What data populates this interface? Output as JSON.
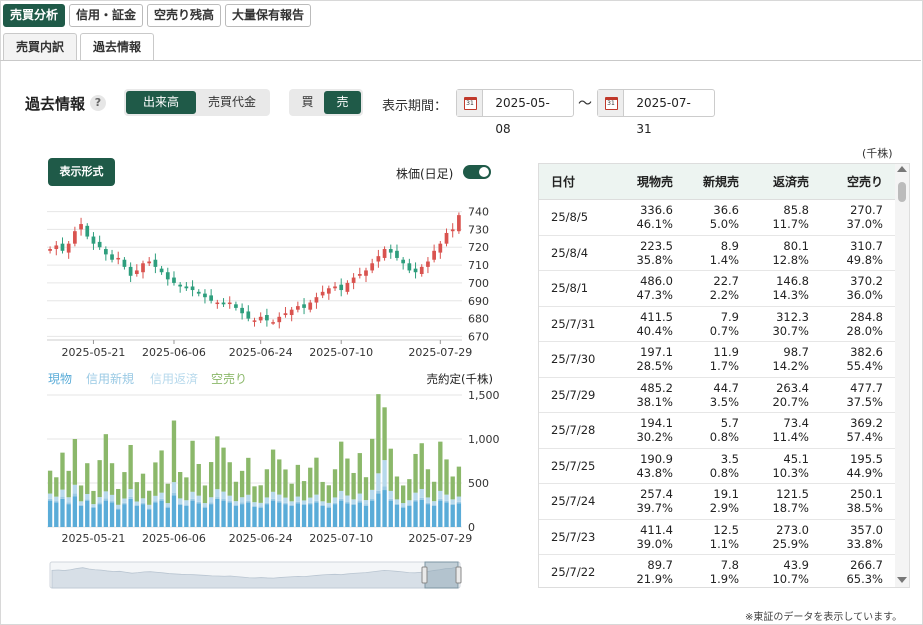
{
  "top_tabs": [
    "売買分析",
    "信用・証金",
    "空売り残高",
    "大量保有報告"
  ],
  "sub_tabs": [
    "売買内訳",
    "過去情報"
  ],
  "controls": {
    "title": "過去情報",
    "help_icon": "?",
    "metric_toggle": [
      "出来高",
      "売買代金"
    ],
    "side_toggle": [
      "買",
      "売"
    ],
    "period_label": "表示期間：",
    "start_date": "2025-05-08",
    "tilde": "〜",
    "end_date": "2025-07-31",
    "format_button": "表示形式",
    "price_label": "株価(日足)"
  },
  "legend": [
    "現物",
    "信用新規",
    "信用返済",
    "空売り"
  ],
  "colors": {
    "accent": "#1f5a48",
    "up": "#d9534f",
    "down": "#2e9e7d",
    "genbutsu": "#5aacd8",
    "shinki": "#99c9e4",
    "hensai": "#b7d9ec",
    "karauri": "#8bb86a"
  },
  "chart_data": [
    {
      "type": "candlestick",
      "x_ticks": [
        "2025-05-21",
        "2025-06-06",
        "2025-06-24",
        "2025-07-10",
        "2025-07-29"
      ],
      "y_ticks": [
        670,
        680,
        690,
        700,
        710,
        720,
        730,
        740
      ],
      "ylim": [
        668,
        742
      ],
      "close": [
        719,
        721,
        718,
        722,
        729,
        733,
        726,
        722,
        720,
        716,
        713,
        714,
        709,
        704,
        707,
        711,
        712,
        709,
        706,
        702,
        700,
        698,
        697,
        696,
        694,
        692,
        690,
        689,
        688,
        689,
        686,
        683,
        680,
        679,
        681,
        679,
        678,
        681,
        683,
        685,
        687,
        686,
        689,
        692,
        695,
        697,
        698,
        696,
        700,
        703,
        705,
        707,
        711,
        715,
        719,
        717,
        714,
        711,
        707,
        706,
        709,
        712,
        718,
        722,
        728,
        730,
        738
      ]
    },
    {
      "type": "stacked-bar",
      "ylabel": "売約定(千株)",
      "y_ticks": [
        0,
        500,
        1000,
        1500
      ],
      "ylim": [
        0,
        1500
      ],
      "series": [
        {
          "name": "現物",
          "values": [
            300,
            280,
            320,
            260,
            350,
            240,
            300,
            220,
            260,
            300,
            280,
            200,
            260,
            320,
            240,
            260,
            200,
            280,
            300,
            220,
            360,
            250,
            240,
            300,
            270,
            220,
            260,
            320,
            300,
            280,
            240,
            260,
            280,
            230,
            220,
            260,
            300,
            280,
            260,
            240,
            270,
            250,
            260,
            280,
            240,
            220,
            260,
            300,
            270,
            250,
            280,
            240,
            300,
            380,
            420,
            300,
            250,
            220,
            240,
            290,
            310,
            260,
            240,
            300,
            280,
            250,
            270
          ]
        },
        {
          "name": "信用新規",
          "values": [
            20,
            15,
            25,
            18,
            30,
            12,
            15,
            10,
            20,
            25,
            15,
            12,
            14,
            22,
            10,
            16,
            12,
            14,
            20,
            12,
            30,
            15,
            14,
            20,
            16,
            12,
            18,
            20,
            22,
            16,
            14,
            18,
            16,
            12,
            14,
            16,
            20,
            18,
            14,
            12,
            16,
            12,
            14,
            18,
            12,
            14,
            16,
            20,
            18,
            14,
            20,
            16,
            22,
            30,
            40,
            20,
            14,
            12,
            14,
            20,
            22,
            16,
            14,
            20,
            18,
            14,
            16
          ]
        },
        {
          "name": "信用返済",
          "values": [
            60,
            50,
            80,
            60,
            100,
            40,
            60,
            30,
            60,
            80,
            70,
            40,
            50,
            90,
            40,
            50,
            40,
            60,
            70,
            40,
            120,
            60,
            50,
            80,
            70,
            40,
            60,
            90,
            80,
            60,
            40,
            60,
            70,
            40,
            40,
            60,
            80,
            70,
            60,
            40,
            60,
            40,
            60,
            70,
            40,
            40,
            60,
            90,
            70,
            50,
            80,
            50,
            100,
            200,
            300,
            90,
            50,
            40,
            50,
            80,
            100,
            60,
            40,
            90,
            70,
            50,
            60
          ]
        },
        {
          "name": "空売り",
          "values": [
            260,
            220,
            420,
            300,
            520,
            180,
            350,
            150,
            420,
            650,
            360,
            180,
            300,
            500,
            220,
            280,
            160,
            380,
            480,
            220,
            700,
            300,
            260,
            580,
            360,
            200,
            400,
            600,
            500,
            380,
            220,
            300,
            420,
            180,
            200,
            320,
            480,
            400,
            320,
            200,
            360,
            220,
            340,
            420,
            220,
            200,
            320,
            560,
            420,
            300,
            460,
            260,
            580,
            900,
            600,
            480,
            260,
            200,
            240,
            440,
            520,
            320,
            220,
            560,
            400,
            260,
            340
          ]
        }
      ]
    }
  ],
  "table": {
    "unit": "(千株)",
    "headers": [
      "日付",
      "現物売",
      "新規売",
      "返済売",
      "空売り"
    ],
    "rows": [
      {
        "date": "25/8/5",
        "v": [
          [
            "336.6",
            "46.1%"
          ],
          [
            "36.6",
            "5.0%"
          ],
          [
            "85.8",
            "11.7%"
          ],
          [
            "270.7",
            "37.0%"
          ]
        ]
      },
      {
        "date": "25/8/4",
        "v": [
          [
            "223.5",
            "35.8%"
          ],
          [
            "8.9",
            "1.4%"
          ],
          [
            "80.1",
            "12.8%"
          ],
          [
            "310.7",
            "49.8%"
          ]
        ]
      },
      {
        "date": "25/8/1",
        "v": [
          [
            "486.0",
            "47.3%"
          ],
          [
            "22.7",
            "2.2%"
          ],
          [
            "146.8",
            "14.3%"
          ],
          [
            "370.2",
            "36.0%"
          ]
        ]
      },
      {
        "date": "25/7/31",
        "v": [
          [
            "411.5",
            "40.4%"
          ],
          [
            "7.9",
            "0.7%"
          ],
          [
            "312.3",
            "30.7%"
          ],
          [
            "284.8",
            "28.0%"
          ]
        ]
      },
      {
        "date": "25/7/30",
        "v": [
          [
            "197.1",
            "28.5%"
          ],
          [
            "11.9",
            "1.7%"
          ],
          [
            "98.7",
            "14.2%"
          ],
          [
            "382.6",
            "55.4%"
          ]
        ]
      },
      {
        "date": "25/7/29",
        "v": [
          [
            "485.2",
            "38.1%"
          ],
          [
            "44.7",
            "3.5%"
          ],
          [
            "263.4",
            "20.7%"
          ],
          [
            "477.7",
            "37.5%"
          ]
        ]
      },
      {
        "date": "25/7/28",
        "v": [
          [
            "194.1",
            "30.2%"
          ],
          [
            "5.7",
            "0.8%"
          ],
          [
            "73.4",
            "11.4%"
          ],
          [
            "369.2",
            "57.4%"
          ]
        ]
      },
      {
        "date": "25/7/25",
        "v": [
          [
            "190.9",
            "43.8%"
          ],
          [
            "3.5",
            "0.8%"
          ],
          [
            "45.1",
            "10.3%"
          ],
          [
            "195.5",
            "44.9%"
          ]
        ]
      },
      {
        "date": "25/7/24",
        "v": [
          [
            "257.4",
            "39.7%"
          ],
          [
            "19.1",
            "2.9%"
          ],
          [
            "121.5",
            "18.7%"
          ],
          [
            "250.1",
            "38.5%"
          ]
        ]
      },
      {
        "date": "25/7/23",
        "v": [
          [
            "411.4",
            "39.0%"
          ],
          [
            "12.5",
            "1.1%"
          ],
          [
            "273.0",
            "25.9%"
          ],
          [
            "357.0",
            "33.8%"
          ]
        ]
      },
      {
        "date": "25/7/22",
        "v": [
          [
            "89.7",
            "21.9%"
          ],
          [
            "7.8",
            "1.9%"
          ],
          [
            "43.9",
            "10.7%"
          ],
          [
            "266.7",
            "65.3%"
          ]
        ]
      }
    ]
  },
  "footnote": "※東証のデータを表示しています。"
}
